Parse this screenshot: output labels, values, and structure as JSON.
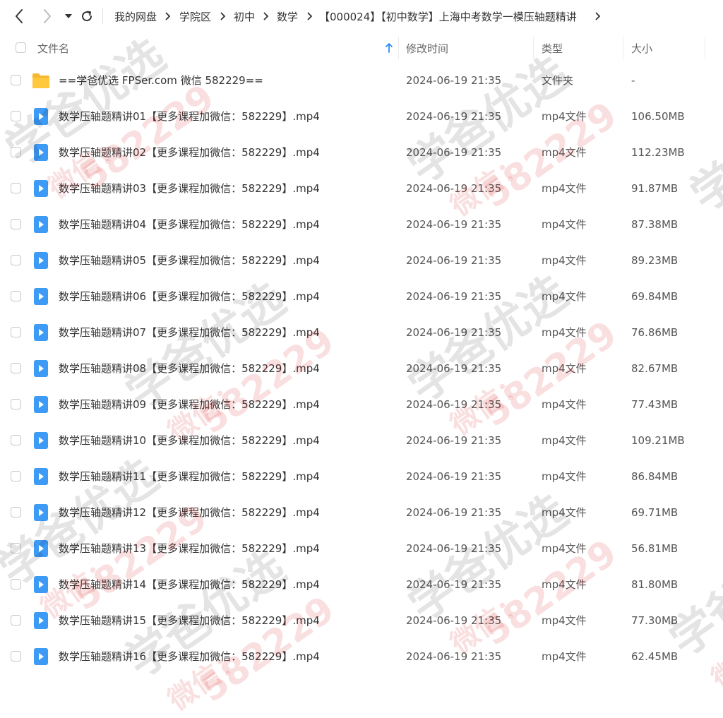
{
  "toolbar": {
    "breadcrumbs": [
      {
        "label": "我的网盘"
      },
      {
        "label": "学院区"
      },
      {
        "label": "初中"
      },
      {
        "label": "数学"
      },
      {
        "label": "【000024】【初中数学】上海中考数学一模压轴题精讲"
      }
    ],
    "icons": {
      "back": "arrow-left-icon",
      "forward": "arrow-right-icon",
      "history": "caret-down-icon",
      "refresh": "refresh-icon"
    }
  },
  "header": {
    "name": "文件名",
    "modified": "修改时间",
    "type": "类型",
    "size": "大小",
    "sort_icon": "sort-up-arrow-icon"
  },
  "files": [
    {
      "name": "==学爸优选 FPSer.com 微信 582229==",
      "modified": "2024-06-19 21:35",
      "type": "文件夹",
      "size": "-",
      "icon": "folder-icon"
    },
    {
      "name": "数学压轴题精讲01【更多课程加微信：582229】.mp4",
      "modified": "2024-06-19 21:35",
      "type": "mp4文件",
      "size": "106.50MB",
      "icon": "video-file-icon"
    },
    {
      "name": "数学压轴题精讲02【更多课程加微信：582229】.mp4",
      "modified": "2024-06-19 21:35",
      "type": "mp4文件",
      "size": "112.23MB",
      "icon": "video-file-icon"
    },
    {
      "name": "数学压轴题精讲03【更多课程加微信：582229】.mp4",
      "modified": "2024-06-19 21:35",
      "type": "mp4文件",
      "size": "91.87MB",
      "icon": "video-file-icon"
    },
    {
      "name": "数学压轴题精讲04【更多课程加微信：582229】.mp4",
      "modified": "2024-06-19 21:35",
      "type": "mp4文件",
      "size": "87.38MB",
      "icon": "video-file-icon"
    },
    {
      "name": "数学压轴题精讲05【更多课程加微信：582229】.mp4",
      "modified": "2024-06-19 21:35",
      "type": "mp4文件",
      "size": "89.23MB",
      "icon": "video-file-icon"
    },
    {
      "name": "数学压轴题精讲06【更多课程加微信：582229】.mp4",
      "modified": "2024-06-19 21:35",
      "type": "mp4文件",
      "size": "69.84MB",
      "icon": "video-file-icon"
    },
    {
      "name": "数学压轴题精讲07【更多课程加微信：582229】.mp4",
      "modified": "2024-06-19 21:35",
      "type": "mp4文件",
      "size": "76.86MB",
      "icon": "video-file-icon"
    },
    {
      "name": "数学压轴题精讲08【更多课程加微信：582229】.mp4",
      "modified": "2024-06-19 21:35",
      "type": "mp4文件",
      "size": "82.67MB",
      "icon": "video-file-icon"
    },
    {
      "name": "数学压轴题精讲09【更多课程加微信：582229】.mp4",
      "modified": "2024-06-19 21:35",
      "type": "mp4文件",
      "size": "77.43MB",
      "icon": "video-file-icon"
    },
    {
      "name": "数学压轴题精讲10【更多课程加微信：582229】.mp4",
      "modified": "2024-06-19 21:35",
      "type": "mp4文件",
      "size": "109.21MB",
      "icon": "video-file-icon"
    },
    {
      "name": "数学压轴题精讲11【更多课程加微信：582229】.mp4",
      "modified": "2024-06-19 21:35",
      "type": "mp4文件",
      "size": "86.84MB",
      "icon": "video-file-icon"
    },
    {
      "name": "数学压轴题精讲12【更多课程加微信：582229】.mp4",
      "modified": "2024-06-19 21:35",
      "type": "mp4文件",
      "size": "69.71MB",
      "icon": "video-file-icon"
    },
    {
      "name": "数学压轴题精讲13【更多课程加微信：582229】.mp4",
      "modified": "2024-06-19 21:35",
      "type": "mp4文件",
      "size": "56.81MB",
      "icon": "video-file-icon"
    },
    {
      "name": "数学压轴题精讲14【更多课程加微信：582229】.mp4",
      "modified": "2024-06-19 21:35",
      "type": "mp4文件",
      "size": "81.80MB",
      "icon": "video-file-icon"
    },
    {
      "name": "数学压轴题精讲15【更多课程加微信：582229】.mp4",
      "modified": "2024-06-19 21:35",
      "type": "mp4文件",
      "size": "77.30MB",
      "icon": "video-file-icon"
    },
    {
      "name": "数学压轴题精讲16【更多课程加微信：582229】.mp4",
      "modified": "2024-06-19 21:35",
      "type": "mp4文件",
      "size": "62.45MB",
      "icon": "video-file-icon"
    }
  ],
  "watermark": {
    "text_cn": "学爸优选",
    "text_wx": "微信：",
    "text_num": "582229"
  },
  "colors": {
    "folder": "#F5B82E",
    "video": "#3E9BF5",
    "sort_arrow": "#2E8CF0"
  }
}
